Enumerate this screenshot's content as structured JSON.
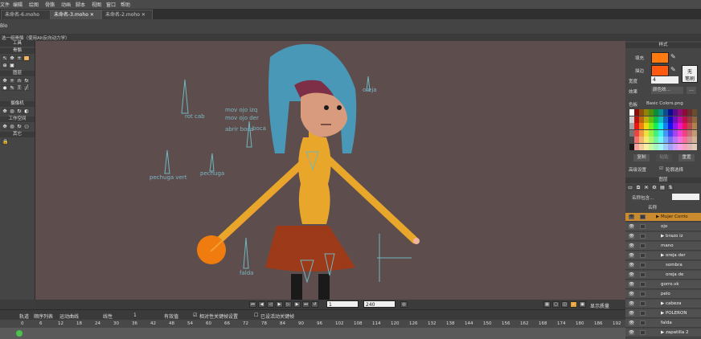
{
  "menubar": {
    "items": [
      "文件",
      "编辑",
      "绘图",
      "骨骼",
      "动画",
      "脚本",
      "视图",
      "窗口",
      "帮助"
    ]
  },
  "tabs": [
    {
      "label": "未命名-6.moho",
      "closable": false,
      "active": false
    },
    {
      "label": "未命名-3.moho",
      "closable": true,
      "active": true
    },
    {
      "label": "未命名-2.moho",
      "closable": true,
      "active": false
    }
  ],
  "toolopts": {
    "label": "Blo"
  },
  "status": {
    "text": "选一组骨骼（使用Alt反向动力学）"
  },
  "tools": {
    "header": "工具",
    "sections": [
      {
        "label": "骨骼"
      },
      {
        "label": "图层"
      },
      {
        "label": "摄像机"
      },
      {
        "label": "工作空间"
      },
      {
        "label": "其它"
      }
    ]
  },
  "canvas": {
    "bone_labels": [
      {
        "text": "rot cab"
      },
      {
        "text": "mov ojo izq"
      },
      {
        "text": "mov ojo der"
      },
      {
        "text": "abrir boca"
      },
      {
        "text": "boca"
      },
      {
        "text": "oreja"
      },
      {
        "text": "pechuga vert"
      },
      {
        "text": "pechuga"
      },
      {
        "text": "falda"
      }
    ],
    "colors": {
      "background": "#5d4e4d",
      "hair": "#4a98b8",
      "skin": "#d89b7e",
      "shirt": "#e8a72a",
      "skirt": "#9c3a1a",
      "bone": "#f0a030",
      "hand_ball": "#f07c10"
    }
  },
  "playbar": {
    "frame_current": "1",
    "frame_end": "240",
    "display_label": "显示质量"
  },
  "timeline": {
    "tabs": [
      "轨道",
      "顺序列表",
      "运动曲线"
    ],
    "mode": "线性",
    "step": "1",
    "auto_label": "有效值",
    "relative_label": "相对性关键帧设置",
    "onion_label": "已设活动关键帧",
    "ticks": [
      "0",
      "6",
      "12",
      "18",
      "24",
      "30",
      "36",
      "42",
      "48",
      "54",
      "60",
      "66",
      "72",
      "78",
      "84",
      "90",
      "96",
      "102",
      "108",
      "114",
      "120",
      "126",
      "132",
      "138",
      "144",
      "150",
      "156",
      "162",
      "168",
      "174",
      "180",
      "186",
      "192"
    ]
  },
  "style": {
    "header": "样式",
    "fill_label": "填充",
    "stroke_label": "描边",
    "fill_color": "#ff7a10",
    "stroke_color": "#ff5a10",
    "width_label": "宽度",
    "width_value": "4",
    "none_label": "无",
    "brush_label": "笔刷",
    "effect_label": "效果",
    "effect_value": "颜色效…",
    "palette_label": "色板",
    "palette_name": "Basic Colors.png",
    "copy_label": "复制",
    "paste_label": "粘贴",
    "reset_label": "重置",
    "advanced_label": "高级设置",
    "select_label": "轮廓选择"
  },
  "layers": {
    "header": "图层",
    "search_placeholder": "名称包含…",
    "name_col": "名称",
    "items": [
      {
        "name": "Mujer Corrio",
        "indent": 0,
        "selected": true,
        "group": true
      },
      {
        "name": "ojo",
        "indent": 1
      },
      {
        "name": "brazo iz",
        "indent": 1,
        "group": true
      },
      {
        "name": "mano",
        "indent": 1
      },
      {
        "name": "oreja der",
        "indent": 1,
        "group": true
      },
      {
        "name": "sombra",
        "indent": 2
      },
      {
        "name": "oreja de",
        "indent": 2
      },
      {
        "name": "gorro.vk",
        "indent": 1
      },
      {
        "name": "pelo",
        "indent": 1
      },
      {
        "name": "cabeza",
        "indent": 1,
        "group": true
      },
      {
        "name": "POLERON",
        "indent": 1,
        "group": true
      },
      {
        "name": "falda",
        "indent": 1
      },
      {
        "name": "zapatilla 2",
        "indent": 1,
        "group": true
      }
    ]
  }
}
